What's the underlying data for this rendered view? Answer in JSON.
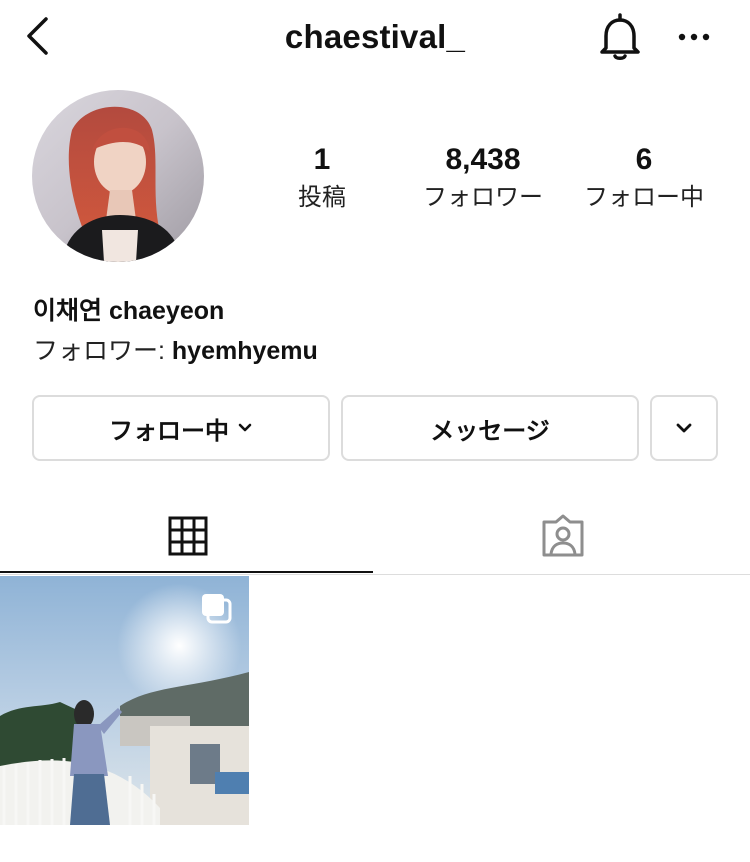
{
  "header": {
    "username": "chaestival_",
    "back_icon": "chevron-left-icon",
    "notify_icon": "bell-icon",
    "more_icon": "more-horizontal-icon"
  },
  "profile": {
    "display_name": "이채연 chaeyeon",
    "followed_by_prefix": "フォロワー: ",
    "followed_by_user": "hyemhyemu"
  },
  "stats": {
    "posts": {
      "count": "1",
      "label": "投稿"
    },
    "followers": {
      "count": "8,438",
      "label": "フォロワー"
    },
    "following": {
      "count": "6",
      "label": "フォロー中"
    }
  },
  "actions": {
    "follow_label": "フォロー中",
    "message_label": "メッセージ"
  },
  "tabs": [
    {
      "name": "grid",
      "icon": "grid-icon",
      "active": true
    },
    {
      "name": "tagged",
      "icon": "tagged-person-icon",
      "active": false
    }
  ],
  "posts": [
    {
      "type": "multi-photo",
      "icon": "carousel-icon"
    }
  ],
  "colors": {
    "accent_text": "#111111",
    "border": "#dcdcdc",
    "inactive_icon": "#8e8e8e"
  }
}
